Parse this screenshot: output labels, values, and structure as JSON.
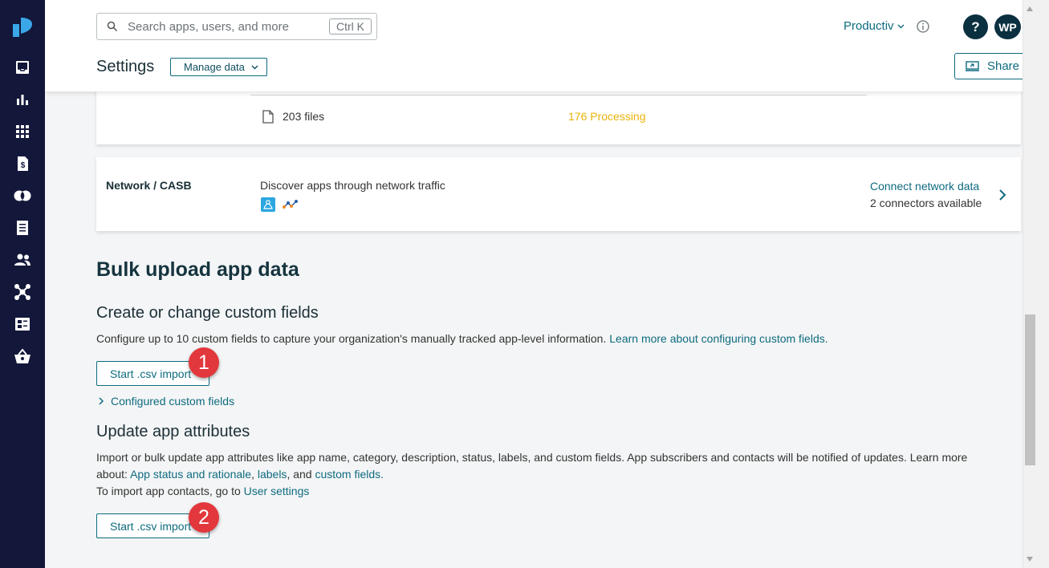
{
  "header": {
    "search_placeholder": "Search apps, users, and more",
    "search_shortcut": "Ctrl K",
    "org_name": "Productiv",
    "help_label": "?",
    "avatar_initials": "WP",
    "page_title": "Settings",
    "manage_select": "Manage data",
    "share_label": "Share"
  },
  "sidenav": {
    "items": [
      "inbox-icon",
      "bar-chart-icon",
      "apps-grid-icon",
      "invoice-icon",
      "overlap-icon",
      "contracts-icon",
      "users-icon",
      "integrations-icon",
      "table-icon",
      "basket-icon"
    ]
  },
  "files_card": {
    "file_count": "203 files",
    "processing": "176 Processing"
  },
  "network_card": {
    "title": "Network / CASB",
    "description": "Discover apps through network traffic",
    "connect_link": "Connect network data",
    "connectors": "2 connectors available"
  },
  "bulk": {
    "heading": "Bulk upload app data",
    "custom_fields": {
      "heading": "Create or change custom fields",
      "description": "Configure up to 10 custom fields to capture your organization's manually tracked app-level information.",
      "learn_link": "Learn more about configuring custom fields.",
      "button": "Start .csv import",
      "configured_link": "Configured custom fields"
    },
    "attributes": {
      "heading": "Update app attributes",
      "description": "Import or bulk update app attributes like app name, category, description, status, labels, and custom fields. App subscribers and contacts will be notified of updates. Learn more",
      "about_prefix": "about:",
      "status_link": "App status and rationale",
      "comma": ",",
      "labels_link": "labels",
      "and_text": ", and",
      "custom_link": "custom fields.",
      "contacts_prefix": "To import app contacts, go to",
      "user_settings_link": "User settings",
      "button": "Start .csv import"
    }
  },
  "annotations": {
    "badge1": "1",
    "badge2": "2"
  },
  "colors": {
    "sidenav": "#13173a",
    "link": "#0e6b80",
    "processing": "#e8b30a",
    "badge": "#e2373c"
  }
}
